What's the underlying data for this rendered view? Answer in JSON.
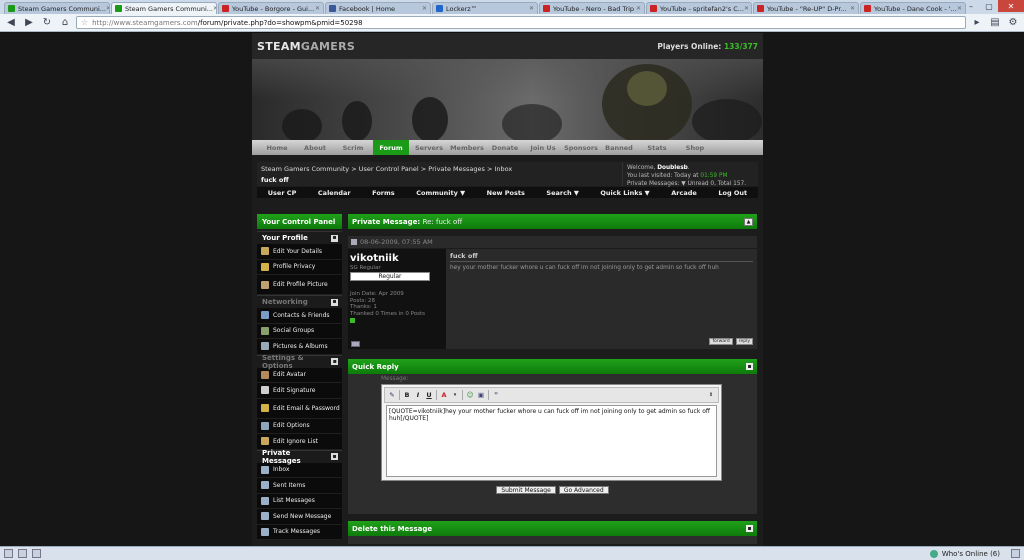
{
  "browser": {
    "tabs": [
      {
        "label": "Steam Gamers Communi...",
        "color": "#1a9a17",
        "active": false
      },
      {
        "label": "Steam Gamers Communi...",
        "color": "#1a9a17",
        "active": true
      },
      {
        "label": "YouTube - Borgore - Gui...",
        "color": "#cc2222",
        "active": false
      },
      {
        "label": "Facebook | Home",
        "color": "#3b5998",
        "active": false
      },
      {
        "label": "Lockerz™",
        "color": "#2266cc",
        "active": false
      },
      {
        "label": "YouTube - Nero - Bad Trip",
        "color": "#cc2222",
        "active": false
      },
      {
        "label": "YouTube - spritefan2's C...",
        "color": "#cc2222",
        "active": false
      },
      {
        "label": "YouTube - \"Re-UP\" D-Pr...",
        "color": "#cc2222",
        "active": false
      },
      {
        "label": "YouTube - Dane Cook - '...",
        "color": "#cc2222",
        "active": false
      }
    ],
    "url_host": "http://www.steamgamers.com",
    "url_path": "/forum/private.php?do=showpm&pmid=50298"
  },
  "site": {
    "logo_a": "STEAM",
    "logo_b": "GAMERS",
    "players_label": "Players Online:",
    "players_value": "133/377",
    "nav": [
      "Home",
      "About",
      "Scrim",
      "Forum",
      "Servers",
      "Members",
      "Donate",
      "Join Us",
      "Sponsors",
      "Banned",
      "Stats",
      "Shop"
    ],
    "nav_active": "Forum"
  },
  "breadcrumb": {
    "path": "Steam Gamers Community > User Control Panel > Private Messages > Inbox",
    "current": "fuck off"
  },
  "welcome": {
    "line1_prefix": "Welcome,",
    "user": "Doublesb",
    "line2_prefix": "You last visited: Today at",
    "line2_time": "01:59 PM",
    "line3": "Private Messages: ▼ Unread 0, Total 157."
  },
  "ucp_nav": [
    "User CP",
    "Calendar",
    "Forms",
    "Community ▼",
    "New Posts",
    "Search ▼",
    "Quick Links ▼",
    "Arcade",
    "Log Out"
  ],
  "sidebar": {
    "title": "Your Control Panel",
    "sections": [
      {
        "title": "Your Profile",
        "dim": false,
        "items": [
          {
            "label": "Edit Your Details",
            "icon": "#c9a85c"
          },
          {
            "label": "Profile Privacy",
            "icon": "#d4b24a"
          },
          {
            "label": "Edit Profile Picture",
            "icon": "#bfa070"
          }
        ]
      },
      {
        "title": "Networking",
        "dim": true,
        "items": [
          {
            "label": "Contacts & Friends",
            "icon": "#7a9cc7"
          },
          {
            "label": "Social Groups",
            "icon": "#8aa06a"
          },
          {
            "label": "Pictures & Albums",
            "icon": "#9aa9b8"
          }
        ]
      },
      {
        "title": "Settings & Options",
        "dim": true,
        "items": [
          {
            "label": "Edit Avatar",
            "icon": "#b58a5a"
          },
          {
            "label": "Edit Signature",
            "icon": "#cfcfcf"
          },
          {
            "label": "Edit Email & Password",
            "icon": "#d4b24a"
          },
          {
            "label": "Edit Options",
            "icon": "#8fa4bd"
          },
          {
            "label": "Edit Ignore List",
            "icon": "#c9a85c"
          }
        ]
      },
      {
        "title": "Private Messages",
        "dim": false,
        "items": [
          {
            "label": "Inbox",
            "icon": "#9ab0c9"
          },
          {
            "label": "Sent Items",
            "icon": "#9ab0c9"
          },
          {
            "label": "List Messages",
            "icon": "#9ab0c9"
          },
          {
            "label": "Send New Message",
            "icon": "#9ab0c9"
          },
          {
            "label": "Track Messages",
            "icon": "#9ab0c9"
          }
        ]
      }
    ]
  },
  "message": {
    "bar_title": "Private Message:",
    "bar_sub": "Re: fuck off",
    "date": "08-06-2009, 07:55 AM",
    "author": "vikotniik",
    "author_title": "SG Regular",
    "rank": "Regular",
    "stats": [
      "Join Date: Apr 2009",
      "Posts: 28",
      "Thanks: 1",
      "Thanked 0 Times in 0 Posts"
    ],
    "title": "fuck off",
    "text": "hey your mother fucker whore u can fuck off im not joining only to get admin so fuck off huh",
    "btn_forward": "forward",
    "btn_reply": "reply"
  },
  "quick_reply": {
    "title": "Quick Reply",
    "label": "Message:",
    "text": "[QUOTE=vikotniik]hey your mother fucker whore u can fuck off im not joining only to get admin so fuck off huh[/QUOTE]",
    "submit": "Submit Message",
    "advanced": "Go Advanced"
  },
  "delete": {
    "title": "Delete this Message"
  },
  "statusbar": {
    "whos_online": "Who's Online (6)"
  }
}
